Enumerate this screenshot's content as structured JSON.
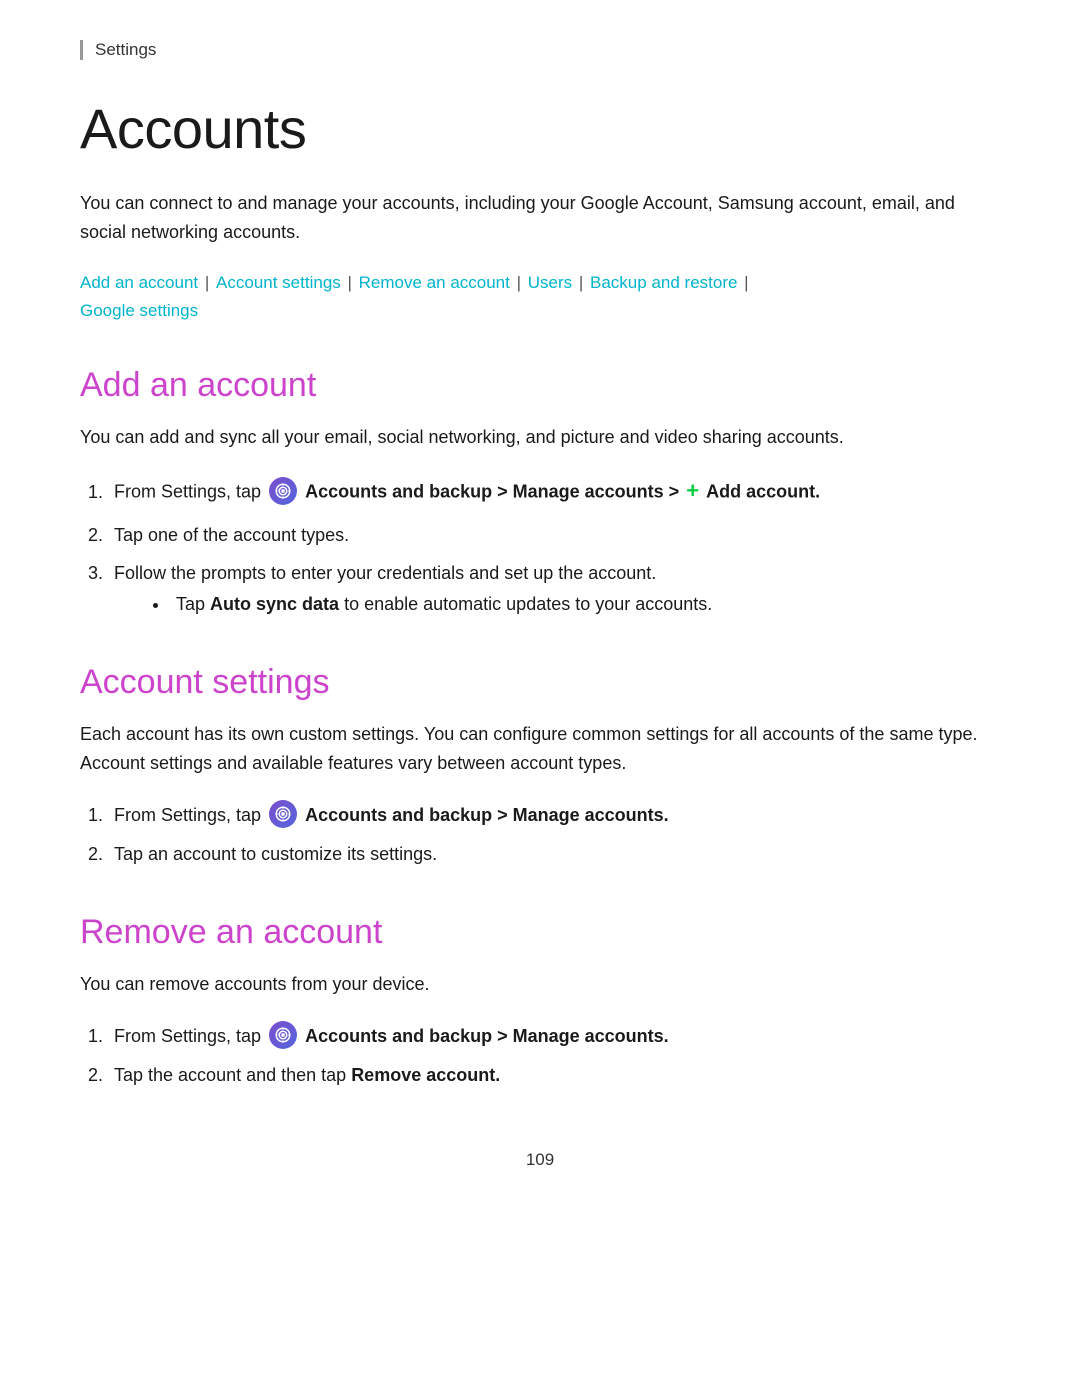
{
  "breadcrumb": "Settings",
  "page_title": "Accounts",
  "intro_text": "You can connect to and manage your accounts, including your Google Account, Samsung account, email, and social networking accounts.",
  "nav_links": [
    {
      "label": "Add an account",
      "href": "#add-an-account"
    },
    {
      "label": "Account settings",
      "href": "#account-settings"
    },
    {
      "label": "Remove an account",
      "href": "#remove-an-account"
    },
    {
      "label": "Users",
      "href": "#users"
    },
    {
      "label": "Backup and restore",
      "href": "#backup-and-restore"
    },
    {
      "label": "Google settings",
      "href": "#google-settings"
    }
  ],
  "sections": [
    {
      "id": "add-an-account",
      "title": "Add an account",
      "description": "You can add and sync all your email, social networking, and picture and video sharing accounts.",
      "steps": [
        {
          "text_before": "From Settings, tap",
          "icon": true,
          "text_bold": "Accounts and backup > Manage accounts >",
          "plus": true,
          "text_bold2": "Add account.",
          "text_after": ""
        },
        {
          "text_plain": "Tap one of the account types."
        },
        {
          "text_plain": "Follow the prompts to enter your credentials and set up the account.",
          "bullets": [
            "Tap Auto sync data to enable automatic updates to your accounts."
          ]
        }
      ]
    },
    {
      "id": "account-settings",
      "title": "Account settings",
      "description": "Each account has its own custom settings. You can configure common settings for all accounts of the same type. Account settings and available features vary between account types.",
      "steps": [
        {
          "text_before": "From Settings, tap",
          "icon": true,
          "text_bold": "Accounts and backup > Manage accounts.",
          "text_after": ""
        },
        {
          "text_plain": "Tap an account to customize its settings."
        }
      ]
    },
    {
      "id": "remove-an-account",
      "title": "Remove an account",
      "description": "You can remove accounts from your device.",
      "steps": [
        {
          "text_before": "From Settings, tap",
          "icon": true,
          "text_bold": "Accounts and backup > Manage accounts.",
          "text_after": ""
        },
        {
          "text_before_plain": "Tap the account and then tap ",
          "text_bold_end": "Remove account.",
          "text_plain": null
        }
      ]
    }
  ],
  "page_number": "109",
  "bullet_label": "Auto sync data",
  "bullet_suffix": "to enable automatic updates to your accounts."
}
